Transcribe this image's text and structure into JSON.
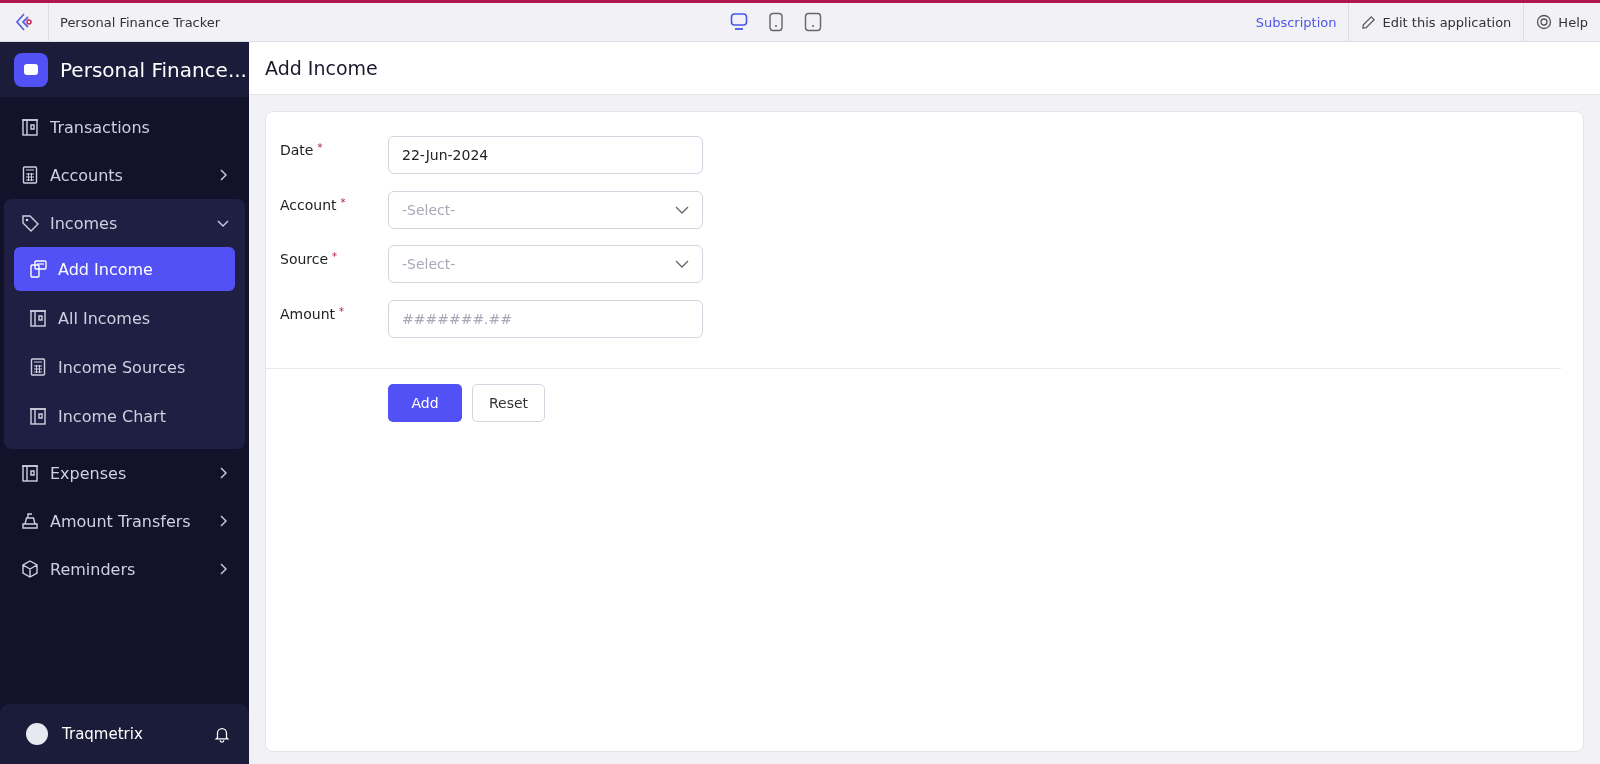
{
  "topbar": {
    "app_title": "Personal Finance Tracker",
    "devices": [
      {
        "kind": "desktop",
        "selected": true
      },
      {
        "kind": "tablet",
        "selected": false
      },
      {
        "kind": "phone",
        "selected": false
      }
    ],
    "links": [
      {
        "kind": "subscription",
        "label": "Subscription"
      },
      {
        "kind": "edit",
        "label": "Edit this application"
      },
      {
        "kind": "help",
        "label": "Help"
      }
    ]
  },
  "sidebar": {
    "title": "Personal Finance...",
    "items": [
      {
        "kind": "card",
        "label": "Transactions",
        "selected": false
      },
      {
        "kind": "calc",
        "label": "Accounts",
        "expanded": false,
        "selected": false
      },
      {
        "kind": "tag",
        "label": "Incomes",
        "expanded": true,
        "selected": false,
        "children": [
          {
            "kind": "form",
            "label": "Add Income",
            "selected": true
          },
          {
            "kind": "card",
            "label": "All Incomes",
            "selected": false
          },
          {
            "kind": "calc",
            "label": "Income Sources",
            "selected": false
          },
          {
            "kind": "card",
            "label": "Income Chart",
            "selected": false
          }
        ]
      },
      {
        "kind": "card",
        "label": "Expenses",
        "expanded": false,
        "selected": false
      },
      {
        "kind": "register",
        "label": "Amount Transfers",
        "expanded": false,
        "selected": false
      },
      {
        "kind": "cube",
        "label": "Reminders",
        "expanded": false,
        "selected": false
      }
    ],
    "user": {
      "name": "Traqmetrix"
    }
  },
  "page": {
    "title": "Add Income"
  },
  "form": {
    "fields": [
      {
        "kind": "text",
        "label": "Date",
        "required_mark": "*",
        "value": "22-Jun-2024"
      },
      {
        "kind": "select",
        "label": "Account",
        "required_mark": "*",
        "placeholder": "-Select-"
      },
      {
        "kind": "select",
        "label": "Source",
        "required_mark": "*",
        "placeholder": "-Select-"
      },
      {
        "kind": "text",
        "label": "Amount",
        "required_mark": "*",
        "placeholder": "#######.##"
      }
    ],
    "buttons": [
      {
        "kind": "primary",
        "label": "Add"
      },
      {
        "kind": "secondary",
        "label": "Reset"
      }
    ]
  }
}
